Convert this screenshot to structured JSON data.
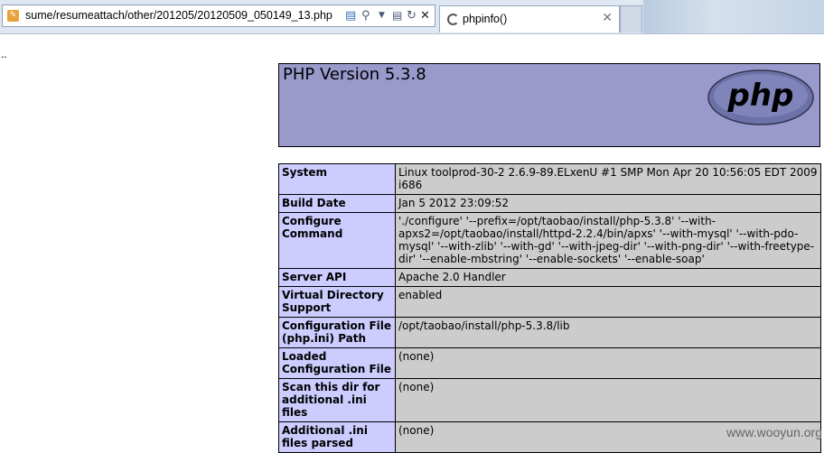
{
  "browser": {
    "url": "sume/resumeattach/other/201205/20120509_050149_13.php",
    "address_icons": [
      "compatibility-icon",
      "search-icon",
      "dropdown-icon",
      "stop-refresh-icon",
      "refresh-icon",
      "close-icon"
    ],
    "tab_title": "phpinfo()"
  },
  "page": {
    "leading_text": "..",
    "version_title": "PHP Version 5.3.8",
    "logo_text": "php",
    "rows": [
      {
        "key": "System",
        "value": "Linux toolprod-30-2 2.6.9-89.ELxenU #1 SMP Mon Apr 20 10:56:05 EDT 2009 i686"
      },
      {
        "key": "Build Date",
        "value": "Jan 5 2012 23:09:52"
      },
      {
        "key": "Configure Command",
        "value": "'./configure' '--prefix=/opt/taobao/install/php-5.3.8' '--with-apxs2=/opt/taobao/install/httpd-2.2.4/bin/apxs' '--with-mysql' '--with-pdo-mysql' '--with-zlib' '--with-gd' '--with-jpeg-dir' '--with-png-dir' '--with-freetype-dir' '--enable-mbstring' '--enable-sockets' '--enable-soap'"
      },
      {
        "key": "Server API",
        "value": "Apache 2.0 Handler"
      },
      {
        "key": "Virtual Directory Support",
        "value": "enabled"
      },
      {
        "key": "Configuration File (php.ini) Path",
        "value": "/opt/taobao/install/php-5.3.8/lib"
      },
      {
        "key": "Loaded Configuration File",
        "value": "(none)"
      },
      {
        "key": "Scan this dir for additional .ini files",
        "value": "(none)"
      },
      {
        "key": "Additional .ini files parsed",
        "value": "(none)"
      }
    ]
  },
  "watermark": "www.wooyun.org",
  "colors": {
    "header_bg": "#9999cc",
    "key_bg": "#ccccff",
    "value_bg": "#cccccc"
  }
}
